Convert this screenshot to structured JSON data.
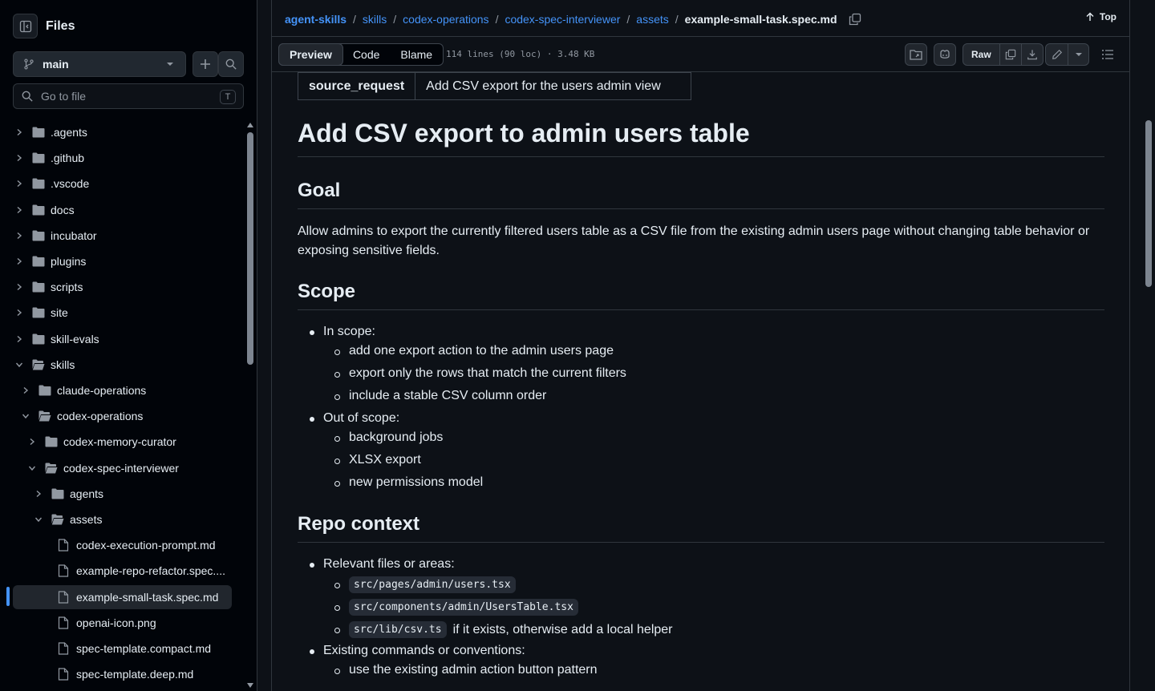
{
  "sidebar": {
    "title": "Files",
    "branch": "main",
    "search_placeholder": "Go to file",
    "search_shortcut": "T",
    "tree": [
      {
        "label": ".agents",
        "type": "folder",
        "depth": 0,
        "expanded": false
      },
      {
        "label": ".github",
        "type": "folder",
        "depth": 0,
        "expanded": false
      },
      {
        "label": ".vscode",
        "type": "folder",
        "depth": 0,
        "expanded": false
      },
      {
        "label": "docs",
        "type": "folder",
        "depth": 0,
        "expanded": false
      },
      {
        "label": "incubator",
        "type": "folder",
        "depth": 0,
        "expanded": false
      },
      {
        "label": "plugins",
        "type": "folder",
        "depth": 0,
        "expanded": false
      },
      {
        "label": "scripts",
        "type": "folder",
        "depth": 0,
        "expanded": false
      },
      {
        "label": "site",
        "type": "folder",
        "depth": 0,
        "expanded": false
      },
      {
        "label": "skill-evals",
        "type": "folder",
        "depth": 0,
        "expanded": false
      },
      {
        "label": "skills",
        "type": "folder",
        "depth": 0,
        "expanded": true
      },
      {
        "label": "claude-operations",
        "type": "folder",
        "depth": 1,
        "expanded": false
      },
      {
        "label": "codex-operations",
        "type": "folder",
        "depth": 1,
        "expanded": true
      },
      {
        "label": "codex-memory-curator",
        "type": "folder",
        "depth": 2,
        "expanded": false
      },
      {
        "label": "codex-spec-interviewer",
        "type": "folder",
        "depth": 2,
        "expanded": true
      },
      {
        "label": "agents",
        "type": "folder",
        "depth": 3,
        "expanded": false
      },
      {
        "label": "assets",
        "type": "folder",
        "depth": 3,
        "expanded": true
      },
      {
        "label": "codex-execution-prompt.md",
        "type": "file",
        "depth": 4
      },
      {
        "label": "example-repo-refactor.spec....",
        "type": "file",
        "depth": 4
      },
      {
        "label": "example-small-task.spec.md",
        "type": "file",
        "depth": 4,
        "selected": true
      },
      {
        "label": "openai-icon.png",
        "type": "file",
        "depth": 4
      },
      {
        "label": "spec-template.compact.md",
        "type": "file",
        "depth": 4
      },
      {
        "label": "spec-template.deep.md",
        "type": "file",
        "depth": 4
      }
    ]
  },
  "breadcrumb": [
    "agent-skills",
    "skills",
    "codex-operations",
    "codex-spec-interviewer",
    "assets"
  ],
  "current_file": "example-small-task.spec.md",
  "top_label": "Top",
  "toolbar": {
    "tabs": [
      "Preview",
      "Code",
      "Blame"
    ],
    "active_tab": "Preview",
    "file_info": "114 lines (90 loc) · 3.48 KB",
    "raw_label": "Raw"
  },
  "doc": {
    "frontmatter": {
      "key": "source_request",
      "value": "Add CSV export for the users admin view"
    },
    "title": "Add CSV export to admin users table",
    "goal_heading": "Goal",
    "goal_text": "Allow admins to export the currently filtered users table as a CSV file from the existing admin users page without changing table behavior or exposing sensitive fields.",
    "scope_heading": "Scope",
    "in_scope_label": "In scope:",
    "in_scope": [
      "add one export action to the admin users page",
      "export only the rows that match the current filters",
      "include a stable CSV column order"
    ],
    "out_scope_label": "Out of scope:",
    "out_scope": [
      "background jobs",
      "XLSX export",
      "new permissions model"
    ],
    "repo_heading": "Repo context",
    "relevant_label": "Relevant files or areas:",
    "files": [
      "src/pages/admin/users.tsx",
      "src/components/admin/UsersTable.tsx",
      "src/lib/csv.ts"
    ],
    "csv_note": "if it exists, otherwise add a local helper",
    "commands_label": "Existing commands or conventions:",
    "conventions": [
      "use the existing admin action button pattern"
    ]
  },
  "colors": {
    "link": "#4493f8",
    "bg": "#0d1117",
    "sidebar_bg": "#010409",
    "border": "#30363d",
    "text": "#e6edf3",
    "muted": "#9198a1"
  }
}
